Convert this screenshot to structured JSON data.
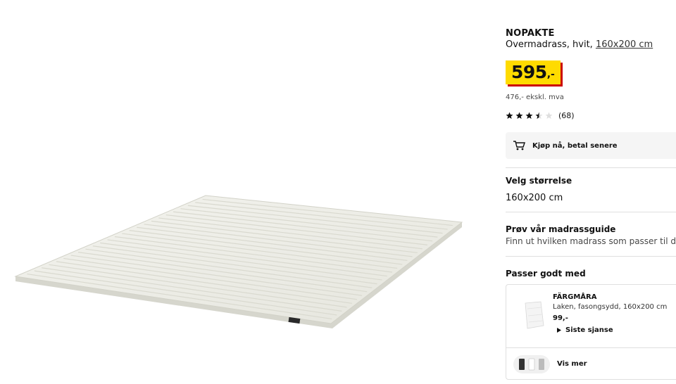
{
  "product": {
    "name": "NOPAKTE",
    "description_prefix": "Overmadrass, hvit, ",
    "size_link": "160x200 cm",
    "price_main": "595",
    "price_suffix": ",-",
    "price_excl_vat": "476,- ekskl. mva",
    "rating": 3.5,
    "rating_max": 5,
    "rating_count": "(68)",
    "image_icon": "mattress-topper-image"
  },
  "payment": {
    "label": "Kjøp nå, betal senere",
    "icon": "shopping-cart-icon"
  },
  "size_selector": {
    "heading": "Velg størrelse",
    "value": "160x200 cm"
  },
  "guide": {
    "heading": "Prøv vår madrassguide",
    "text": "Finn ut hvilken madrass som passer til din sove"
  },
  "pairs_well": {
    "heading": "Passer godt med",
    "item": {
      "name": "FÄRGMÅRA",
      "description": "Laken, fasongsydd, 160x200 cm",
      "price": "99,-",
      "status": "Siste sjanse"
    },
    "see_more": "Vis mer"
  },
  "colors": {
    "price_yellow": "#ffdb00",
    "price_shadow_red": "#cc0008",
    "panel_gray": "#f5f5f5",
    "divider": "#dfdfdf"
  }
}
